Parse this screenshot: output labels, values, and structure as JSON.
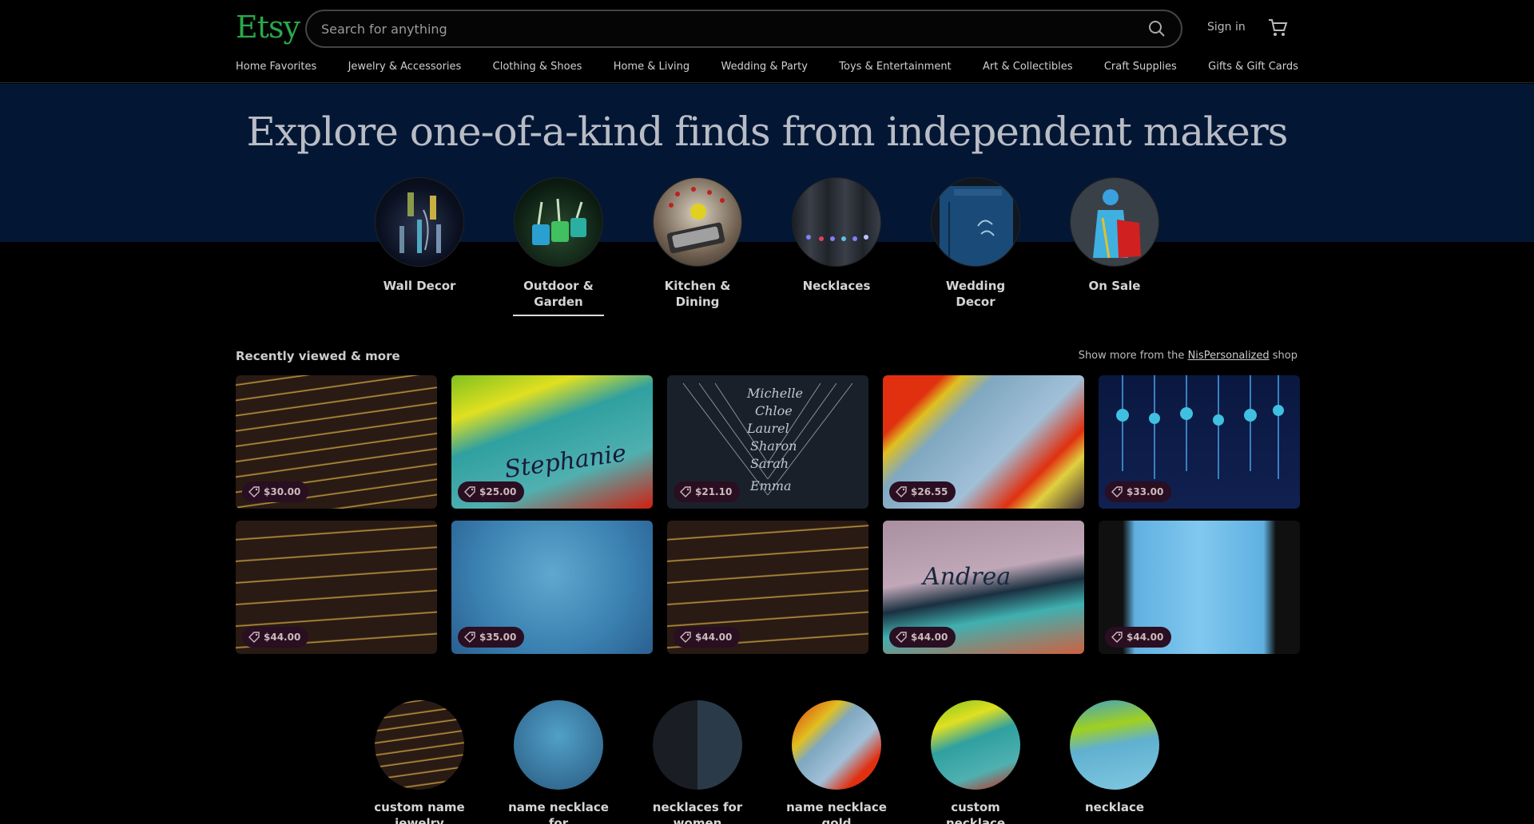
{
  "header": {
    "logo": "Etsy",
    "search_placeholder": "Search for anything",
    "signin": "Sign in"
  },
  "nav": [
    "Home Favorites",
    "Jewelry & Accessories",
    "Clothing & Shoes",
    "Home & Living",
    "Wedding & Party",
    "Toys & Entertainment",
    "Art & Collectibles",
    "Craft Supplies",
    "Gifts & Gift Cards"
  ],
  "hero": {
    "title": "Explore one-of-a-kind finds from independent makers",
    "categories": [
      {
        "label_1": "Wall Decor",
        "label_2": ""
      },
      {
        "label_1": "Outdoor &",
        "label_2": "Garden"
      },
      {
        "label_1": "Kitchen &",
        "label_2": "Dining"
      },
      {
        "label_1": "Necklaces",
        "label_2": ""
      },
      {
        "label_1": "Wedding",
        "label_2": "Decor"
      },
      {
        "label_1": "On Sale",
        "label_2": ""
      }
    ]
  },
  "recent": {
    "title": "Recently viewed & more",
    "more_prefix": "Show more from the",
    "shop_name": "NisPersonalized",
    "more_suffix": "shop",
    "prices": [
      "$30.00",
      "$25.00",
      "$21.10",
      "$26.55",
      "$33.00",
      "$44.00",
      "$35.00",
      "$44.00",
      "$44.00",
      "$44.00"
    ]
  },
  "bottom_categories": [
    "custom name jewelry",
    "name necklace for",
    "necklaces for women",
    "name necklace gold",
    "custom necklace",
    "necklace"
  ],
  "colors": {
    "brand": "#2aa84a",
    "hero_band": "#031735",
    "price_pill": "#2a0e22"
  }
}
